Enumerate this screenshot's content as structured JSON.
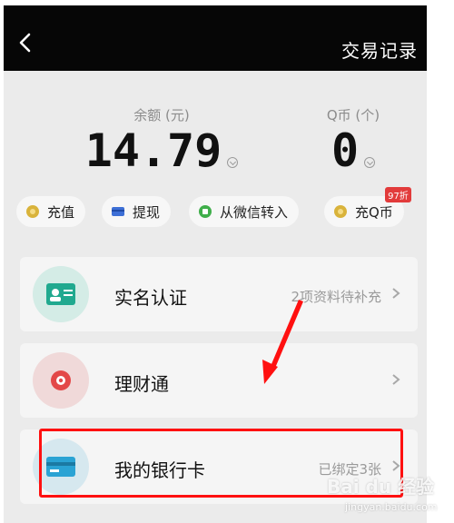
{
  "header": {
    "records_label": "交易记录"
  },
  "balance": {
    "label": "余额 (元)",
    "value": "14.79"
  },
  "qcoin": {
    "label": "Q币 (个)",
    "value": "0"
  },
  "actions": [
    {
      "label": "充值",
      "icon": "coin-icon"
    },
    {
      "label": "提现",
      "icon": "card-icon"
    },
    {
      "label": "从微信转入",
      "icon": "wechat-icon"
    },
    {
      "label": "充Q币",
      "icon": "coin-icon",
      "badge": "97折"
    }
  ],
  "rows": [
    {
      "title": "实名认证",
      "subtitle": "2项资料待补充",
      "icon": "id-card-icon"
    },
    {
      "title": "理财通",
      "subtitle": "",
      "icon": "wealth-icon"
    },
    {
      "title": "我的银行卡",
      "subtitle": "已绑定3张",
      "icon": "bank-card-icon"
    }
  ],
  "watermark": {
    "brand": "Bai du 经验",
    "url": "jingyan.baidu.com"
  },
  "colors": {
    "header_bg": "#060606",
    "page_bg": "#ebebeb",
    "highlight": "#ff1010",
    "arrow": "#ff1010"
  }
}
